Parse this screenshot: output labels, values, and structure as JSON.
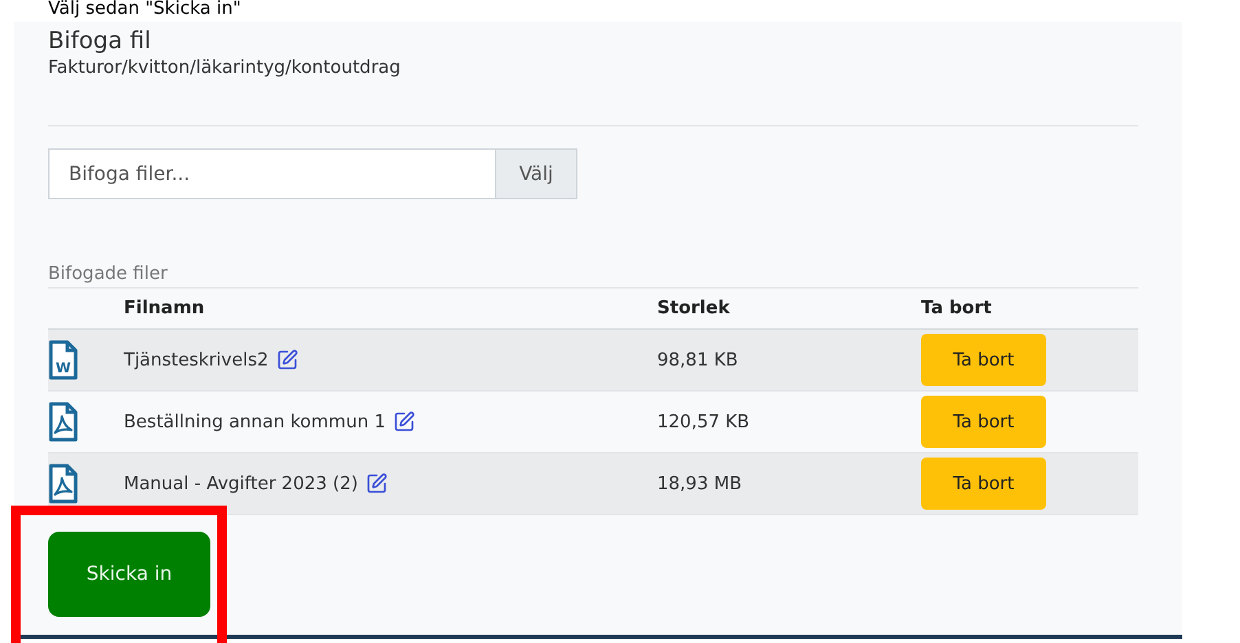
{
  "instruction": "Välj sedan \"Skicka in\"",
  "panel": {
    "title": "Bifoga fil",
    "subtitle": "Fakturor/kvitton/läkarintyg/kontoutdrag"
  },
  "file_input": {
    "placeholder": "Bifoga filer...",
    "button": "Välj"
  },
  "attached": {
    "label": "Bifogade filer",
    "columns": [
      "Filnamn",
      "Storlek",
      "Ta bort"
    ],
    "rows": [
      {
        "kind": "word",
        "icon_text": "W",
        "name": "Tjänsteskrivels2",
        "size": "98,81 KB",
        "action": "Ta bort"
      },
      {
        "kind": "pdf",
        "name": "Beställning annan kommun 1",
        "size": "120,57 KB",
        "action": "Ta bort"
      },
      {
        "kind": "pdf",
        "name": "Manual - Avgifter 2023 (2)",
        "size": "18,93 MB",
        "action": "Ta bort"
      }
    ]
  },
  "submit": {
    "label": "Skicka in",
    "highlighted": true
  }
}
